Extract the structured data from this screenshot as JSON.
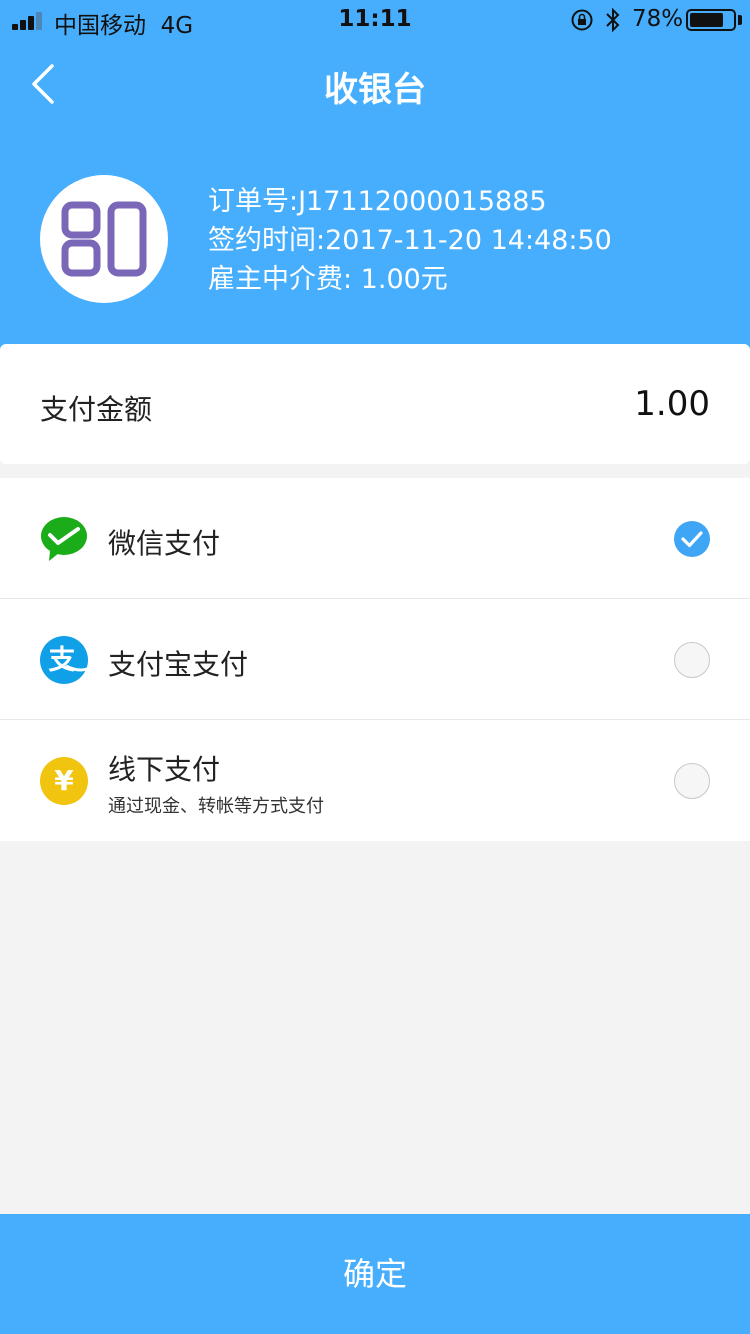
{
  "status_bar": {
    "carrier": "中国移动",
    "network": "4G",
    "time": "11:11",
    "battery_percent": "78%",
    "battery_level": 0.78
  },
  "nav": {
    "title": "收银台"
  },
  "order": {
    "number_line": "订单号:J17112000015885",
    "sign_time_line": "签约时间:2017-11-20 14:48:50",
    "fee_line": "雇主中介费: 1.00元"
  },
  "amount": {
    "label": "支付金额",
    "value": "1.00"
  },
  "methods": [
    {
      "name": "微信支付",
      "sub": "",
      "icon": "wechat-pay-icon",
      "selected": true
    },
    {
      "name": "支付宝支付",
      "sub": "",
      "icon": "alipay-icon",
      "selected": false
    },
    {
      "name": "线下支付",
      "sub": "通过现金、转帐等方式支付",
      "icon": "yuan-icon",
      "selected": false
    }
  ],
  "confirm_label": "确定",
  "colors": {
    "primary": "#46aefc",
    "wechat": "#1aad19",
    "alipay": "#0fa0e8",
    "offline": "#f1c40f",
    "logo": "#7b67b8"
  }
}
